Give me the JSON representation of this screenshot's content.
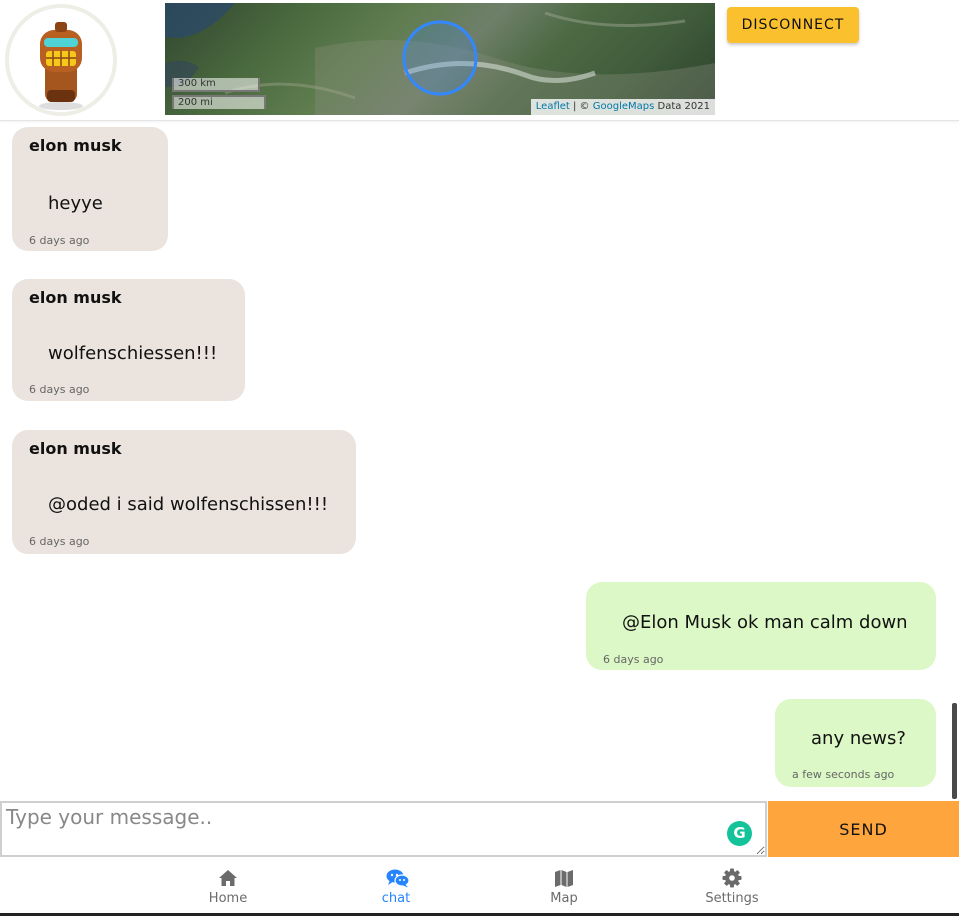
{
  "header": {
    "disconnect_label": "DISCONNECT",
    "map": {
      "scale_km": "300 km",
      "scale_mi": "200 mi",
      "attribution_link": "Leaflet",
      "attribution_sep": " | © ",
      "attribution_provider": "GoogleMaps",
      "attribution_data": " Data 2021"
    }
  },
  "messages": [
    {
      "direction": "in",
      "sender": "elon musk",
      "text": "heyye",
      "time": "6 days ago"
    },
    {
      "direction": "in",
      "sender": "elon musk",
      "text": "wolfenschiessen!!!",
      "time": "6 days ago"
    },
    {
      "direction": "in",
      "sender": "elon musk",
      "text": "@oded i said wolfenschissen!!!",
      "time": "6 days ago"
    },
    {
      "direction": "out",
      "text": "@Elon Musk ok man calm down",
      "time": "6 days ago"
    },
    {
      "direction": "out",
      "text": "any news?",
      "time": "a few seconds ago"
    }
  ],
  "composer": {
    "placeholder": "Type your message..",
    "value": "",
    "grammarly_icon": "G",
    "send_label": "SEND"
  },
  "nav": {
    "items": [
      {
        "label": "Home",
        "icon": "home-icon"
      },
      {
        "label": "chat",
        "icon": "chat-icon",
        "active": true
      },
      {
        "label": "Map",
        "icon": "map-icon"
      },
      {
        "label": "Settings",
        "icon": "gear-icon"
      }
    ]
  },
  "colors": {
    "incoming_bubble": "#ebe4de",
    "outgoing_bubble": "#dcf8c6",
    "disconnect": "#fbc02d",
    "send": "#ffa53d",
    "nav_active": "#2684ff"
  }
}
